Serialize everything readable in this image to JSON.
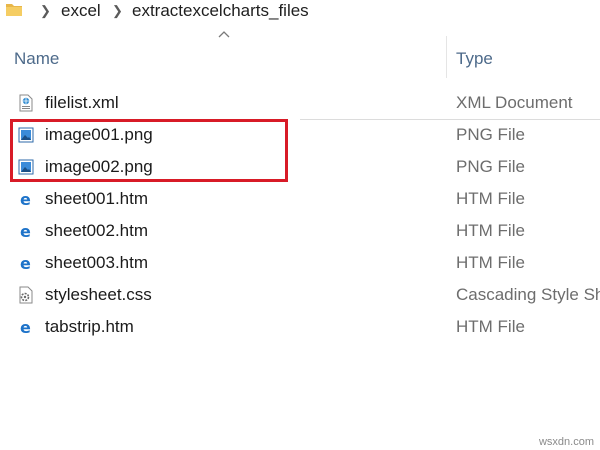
{
  "breadcrumb": {
    "items": [
      "excel",
      "extractexcelcharts_files"
    ]
  },
  "columns": {
    "name": "Name",
    "type": "Type"
  },
  "files": [
    {
      "name": "filelist.xml",
      "type": "XML Document",
      "icon": "xml-file-icon"
    },
    {
      "name": "image001.png",
      "type": "PNG File",
      "icon": "image-file-icon"
    },
    {
      "name": "image002.png",
      "type": "PNG File",
      "icon": "image-file-icon"
    },
    {
      "name": "sheet001.htm",
      "type": "HTM File",
      "icon": "edge-file-icon"
    },
    {
      "name": "sheet002.htm",
      "type": "HTM File",
      "icon": "edge-file-icon"
    },
    {
      "name": "sheet003.htm",
      "type": "HTM File",
      "icon": "edge-file-icon"
    },
    {
      "name": "stylesheet.css",
      "type": "Cascading Style Sheet",
      "icon": "css-file-icon"
    },
    {
      "name": "tabstrip.htm",
      "type": "HTM File",
      "icon": "edge-file-icon"
    }
  ],
  "highlight_color": "#d81b27",
  "watermark": "wsxdn.com"
}
